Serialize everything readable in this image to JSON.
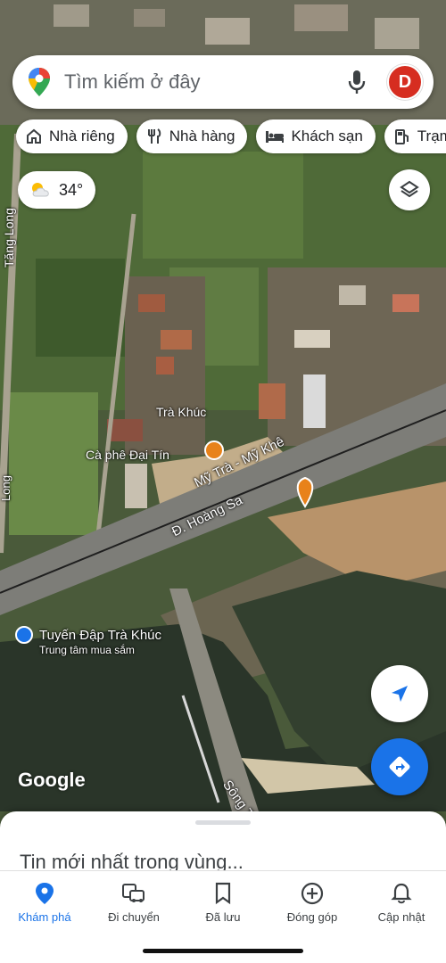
{
  "search": {
    "placeholder": "Tìm kiếm ở đây",
    "avatar_letter": "D"
  },
  "chips": [
    {
      "label": "Nhà riêng",
      "icon": "home-icon"
    },
    {
      "label": "Nhà hàng",
      "icon": "restaurant-icon"
    },
    {
      "label": "Khách sạn",
      "icon": "hotel-icon"
    },
    {
      "label": "Trạm",
      "icon": "gas-station-icon"
    }
  ],
  "weather": {
    "temp": "34°",
    "icon": "partly-cloudy-icon"
  },
  "map_labels": {
    "tang_long": "Tăng Long",
    "tra_khuc": "Trà Khúc",
    "ca_phe": "Cà phê Đại Tín",
    "my_tra": "Mỹ Trà - Mỹ Khê",
    "hoang_sa": "Đ. Hoàng Sa",
    "tuyen_dap": "Tuyến Đập Trà Khúc",
    "trung_tam": "Trung tâm mua sắm",
    "song_tra": "Sông Trà",
    "ssl": "Long"
  },
  "watermark": "Google",
  "sheet": {
    "title": "Tin mới nhất trong vùng..."
  },
  "nav": [
    {
      "label": "Khám phá",
      "icon": "explore-pin-icon",
      "active": true
    },
    {
      "label": "Đi chuyển",
      "icon": "commute-icon",
      "active": false
    },
    {
      "label": "Đã lưu",
      "icon": "bookmark-icon",
      "active": false
    },
    {
      "label": "Đóng góp",
      "icon": "add-circle-icon",
      "active": false
    },
    {
      "label": "Cập nhật",
      "icon": "bell-icon",
      "active": false
    }
  ],
  "colors": {
    "accent": "#1a73e8",
    "brand_red": "#d62d20"
  }
}
